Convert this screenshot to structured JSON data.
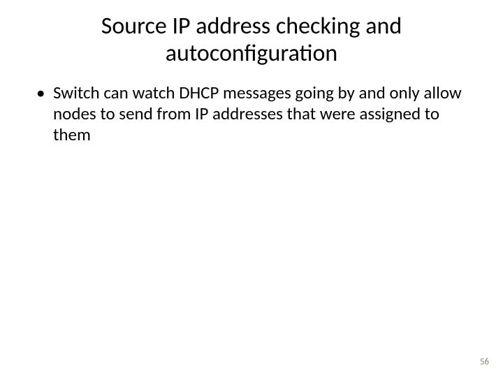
{
  "slide": {
    "title": "Source IP address checking and autoconfiguration",
    "bullets": [
      "Switch can watch DHCP messages going by and only allow nodes to send from IP addresses that were assigned to them"
    ],
    "page_number": "56"
  }
}
